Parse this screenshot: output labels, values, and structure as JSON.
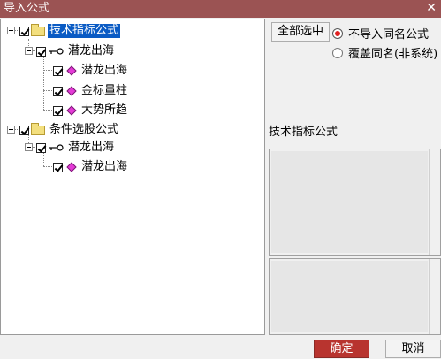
{
  "window": {
    "title": "导入公式",
    "close_glyph": "✕"
  },
  "tree": {
    "nodes": [
      {
        "label": "技术指标公式",
        "type": "folder",
        "checked": true,
        "selected": true
      },
      {
        "label": "潜龙出海",
        "type": "group",
        "checked": true
      },
      {
        "label": "潜龙出海",
        "type": "formula",
        "checked": true
      },
      {
        "label": "金标量柱",
        "type": "formula",
        "checked": true
      },
      {
        "label": "大势所趋",
        "type": "formula",
        "checked": true
      },
      {
        "label": "条件选股公式",
        "type": "folder",
        "checked": true
      },
      {
        "label": "潜龙出海",
        "type": "group",
        "checked": true
      },
      {
        "label": "潜龙出海",
        "type": "formula",
        "checked": true
      }
    ]
  },
  "options": {
    "select_all_label": "全部选中",
    "radio_no_import": "不导入同名公式",
    "radio_overwrite": "覆盖同名(非系统)",
    "selected_radio": "radio_no_import"
  },
  "info": {
    "selected_name": "技术指标公式"
  },
  "footer": {
    "ok_label": "确定",
    "cancel_label": "取消",
    "ok_color": "#b8342f"
  }
}
